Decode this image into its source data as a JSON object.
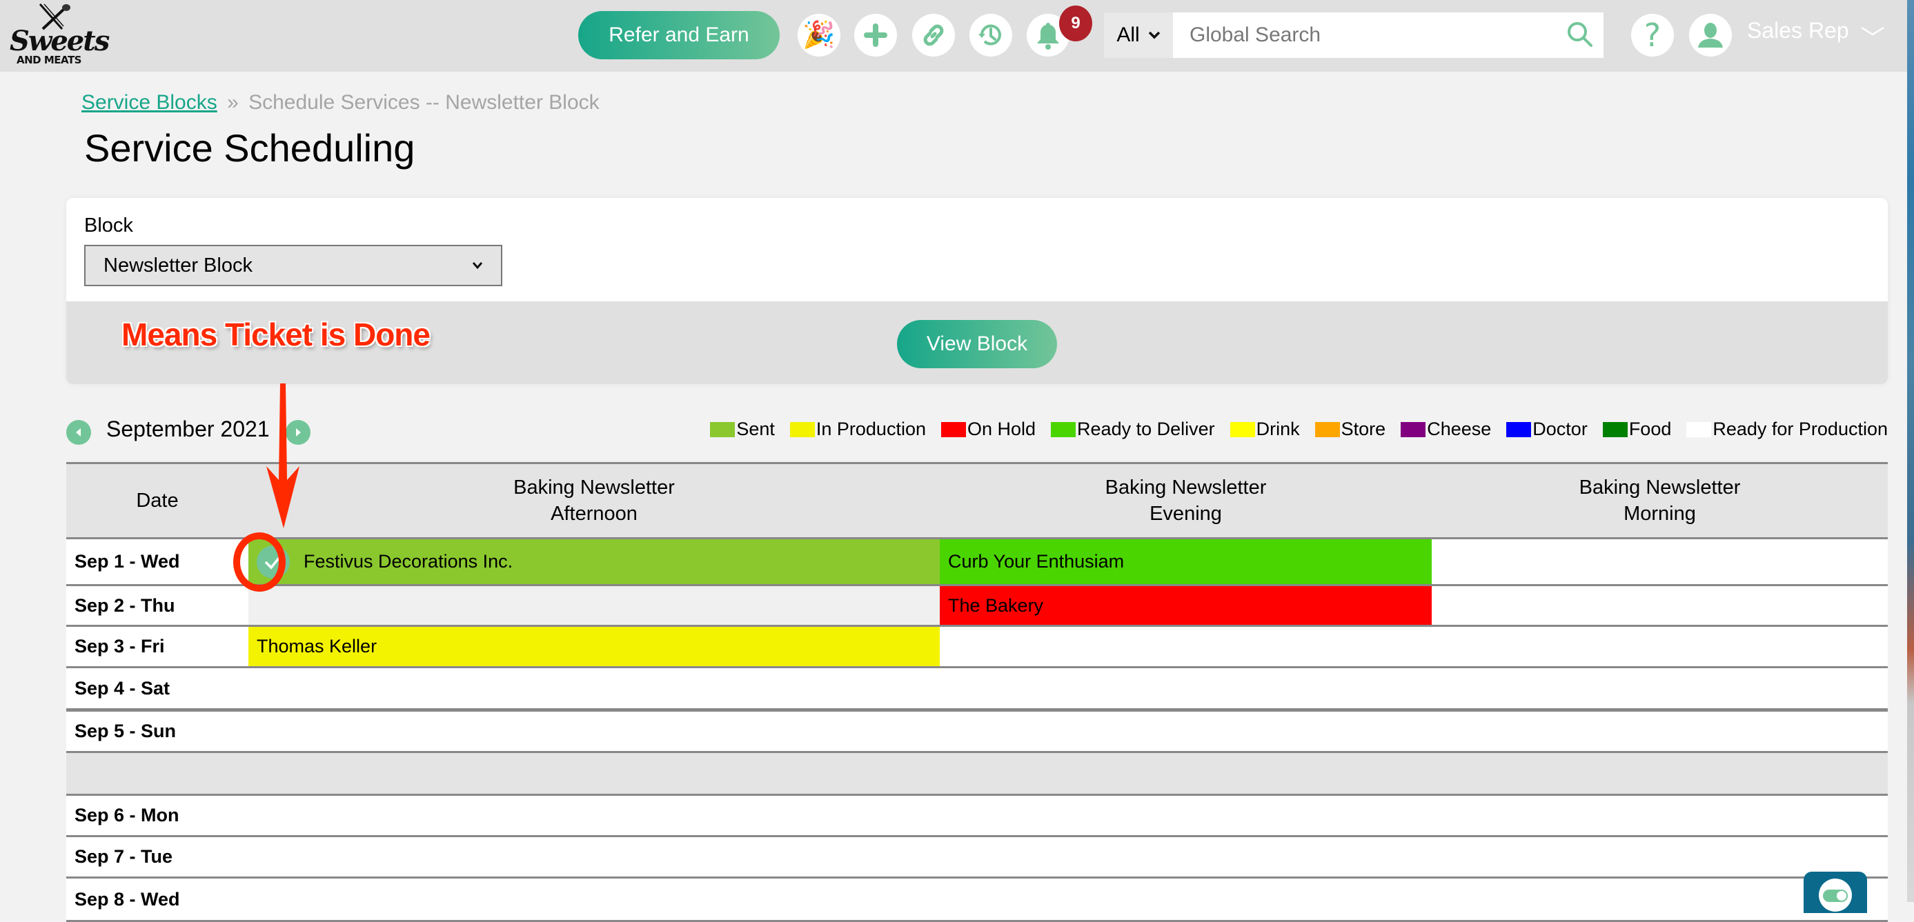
{
  "header": {
    "logo_text": "Sweets",
    "logo_subtext": "AND MEATS",
    "refer_label": "Refer and Earn",
    "notification_count": "9",
    "search_scope": "All",
    "search_placeholder": "Global Search",
    "user_name": "Sales Rep",
    "icons": [
      "party-popper-icon",
      "plus-icon",
      "link-icon",
      "history-icon",
      "bell-icon",
      "search-icon",
      "help-icon",
      "user-icon",
      "chevron-down-icon"
    ]
  },
  "breadcrumb": {
    "link": "Service Blocks",
    "separator": "»",
    "current": "Schedule Services -- Newsletter Block"
  },
  "page_title": "Service Scheduling",
  "block_form": {
    "label": "Block",
    "selected": "Newsletter Block",
    "view_button": "View Block"
  },
  "annotation": {
    "text": "Means Ticket is Done",
    "color": "#ff2a00"
  },
  "calendar": {
    "month": "September 2021",
    "legend": [
      {
        "label": "Sent",
        "color": "#8ac82e"
      },
      {
        "label": "In Production",
        "color": "#f3f300"
      },
      {
        "label": "On Hold",
        "color": "#ff0000"
      },
      {
        "label": "Ready to Deliver",
        "color": "#4bd500"
      },
      {
        "label": "Drink",
        "color": "#ffff00"
      },
      {
        "label": "Store",
        "color": "#ffa500"
      },
      {
        "label": "Cheese",
        "color": "#800080"
      },
      {
        "label": "Doctor",
        "color": "#0000ff"
      },
      {
        "label": "Food",
        "color": "#008000"
      },
      {
        "label": "Ready for Production",
        "color": "#ffffff"
      }
    ],
    "columns": {
      "date": "Date",
      "afternoon_line1": "Baking Newsletter",
      "afternoon_line2": "Afternoon",
      "evening_line1": "Baking Newsletter",
      "evening_line2": "Evening",
      "morning_line1": "Baking Newsletter",
      "morning_line2": "Morning"
    },
    "rows": [
      {
        "date": "Sep 1 - Wed",
        "afternoon": "Festivus Decorations Inc.",
        "afternoon_status": "Sent",
        "afternoon_done": true,
        "evening": "Curb Your Enthusiam",
        "evening_status": "Ready to Deliver",
        "morning": ""
      },
      {
        "date": "Sep 2 - Thu",
        "afternoon": "",
        "evening": "The Bakery",
        "evening_status": "On Hold",
        "morning": ""
      },
      {
        "date": "Sep 3 - Fri",
        "afternoon": "Thomas Keller",
        "afternoon_status": "In Production",
        "evening": "",
        "morning": ""
      },
      {
        "date": "Sep 4 - Sat",
        "afternoon": "",
        "evening": "",
        "morning": ""
      },
      {
        "date": "Sep 5 - Sun",
        "afternoon": "",
        "evening": "",
        "morning": ""
      },
      {
        "date": "Sep 6 - Mon",
        "afternoon": "",
        "evening": "",
        "morning": ""
      },
      {
        "date": "Sep 7 - Tue",
        "afternoon": "",
        "evening": "",
        "morning": ""
      },
      {
        "date": "Sep 8 - Wed",
        "afternoon": "",
        "evening": "",
        "morning": ""
      }
    ]
  }
}
